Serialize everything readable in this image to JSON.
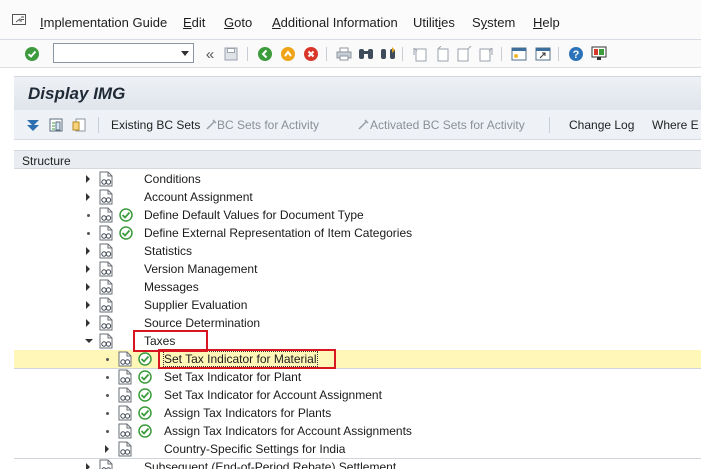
{
  "menu": {
    "items": [
      {
        "pre": "",
        "u": "I",
        "post": "mplementation Guide"
      },
      {
        "pre": "",
        "u": "E",
        "post": "dit"
      },
      {
        "pre": "",
        "u": "G",
        "post": "oto"
      },
      {
        "pre": "",
        "u": "A",
        "post": "dditional Information"
      },
      {
        "pre": "Utilit",
        "u": "i",
        "post": "es"
      },
      {
        "pre": "S",
        "u": "y",
        "post": "stem"
      },
      {
        "pre": "",
        "u": "H",
        "post": "elp"
      }
    ]
  },
  "toolbar": {
    "command_field_value": "",
    "back_glyph": "«"
  },
  "title": "Display IMG",
  "app_toolbar": {
    "existing_bc_sets": "Existing BC Sets",
    "bc_sets_for_activity": "BC Sets for Activity",
    "activated_bc_sets": "Activated BC Sets for Activity",
    "change_log": "Change Log",
    "where_used": "Where E"
  },
  "tree": {
    "header": "Structure",
    "rows": [
      {
        "label": "Conditions",
        "expander": "right",
        "exec": false
      },
      {
        "label": "Account Assignment",
        "expander": "right",
        "exec": false
      },
      {
        "label": "Define Default Values for Document Type",
        "expander": "dot",
        "exec": true
      },
      {
        "label": "Define External Representation of Item Categories",
        "expander": "dot",
        "exec": true
      },
      {
        "label": "Statistics",
        "expander": "right",
        "exec": false
      },
      {
        "label": "Version Management",
        "expander": "right",
        "exec": false
      },
      {
        "label": "Messages",
        "expander": "right",
        "exec": false
      },
      {
        "label": "Supplier Evaluation",
        "expander": "right",
        "exec": false
      },
      {
        "label": "Source Determination",
        "expander": "right",
        "exec": false
      },
      {
        "label": "Taxes",
        "expander": "down",
        "exec": false
      },
      {
        "label": "Set Tax Indicator for Material",
        "expander": "dot",
        "exec": true,
        "selected": true
      },
      {
        "label": "Set Tax Indicator for Plant",
        "expander": "dot",
        "exec": true
      },
      {
        "label": "Set Tax Indicator for Account Assignment",
        "expander": "dot",
        "exec": true
      },
      {
        "label": "Assign Tax Indicators for Plants",
        "expander": "dot",
        "exec": true
      },
      {
        "label": "Assign Tax Indicators for Account Assignments",
        "expander": "dot",
        "exec": true
      },
      {
        "label": "Country-Specific Settings for India",
        "expander": "right",
        "exec": false
      },
      {
        "label": "Subsequent (End-of-Period Rebate) Settlement",
        "expander": "right",
        "exec": false
      }
    ]
  },
  "colors": {
    "highlight_box": "#d8161f",
    "selected_row": "#fff7b8",
    "exec_green": "#3a9b3a"
  },
  "icons": [
    "menu-icon",
    "enter-check-icon",
    "save-icon",
    "back-icon",
    "exit-icon",
    "cancel-icon",
    "print-icon",
    "find-icon",
    "find-next-icon",
    "first-page-icon",
    "previous-page-icon",
    "next-page-icon",
    "last-page-icon",
    "create-session-icon",
    "shortcut-icon",
    "help-icon",
    "customize-layout-icon",
    "expand-subtree-icon",
    "release-notes-icon",
    "documentation-icon",
    "bc-set-icon",
    "document-icon",
    "execute-icon"
  ]
}
